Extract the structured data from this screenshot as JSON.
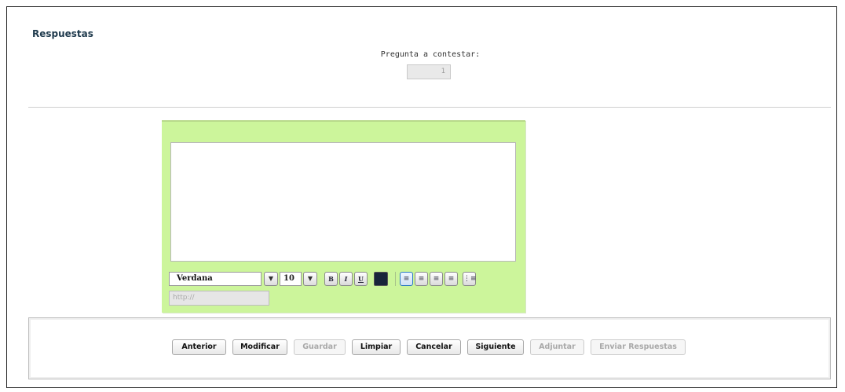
{
  "page": {
    "title": "Respuestas"
  },
  "question": {
    "label": "Pregunta a contestar:",
    "value": "1"
  },
  "editor": {
    "font": "Verdana",
    "size": "10",
    "format_buttons": [
      {
        "label": "B",
        "icon": "bold-icon"
      },
      {
        "label": "I",
        "icon": "italic-icon"
      },
      {
        "label": "U",
        "icon": "underline-icon"
      }
    ],
    "text_color": "#17243a",
    "align_buttons": [
      "align-left-icon",
      "align-center-icon",
      "align-right-icon",
      "align-justify-icon"
    ],
    "url_placeholder": "http://",
    "background_color": "#ccf59b"
  },
  "buttons": [
    {
      "label": "Anterior",
      "enabled": true
    },
    {
      "label": "Modificar",
      "enabled": true
    },
    {
      "label": "Guardar",
      "enabled": false
    },
    {
      "label": "Limpiar",
      "enabled": true
    },
    {
      "label": "Cancelar",
      "enabled": true
    },
    {
      "label": "Siguiente",
      "enabled": true
    },
    {
      "label": "Adjuntar",
      "enabled": false
    },
    {
      "label": "Enviar Respuestas",
      "enabled": false
    }
  ]
}
